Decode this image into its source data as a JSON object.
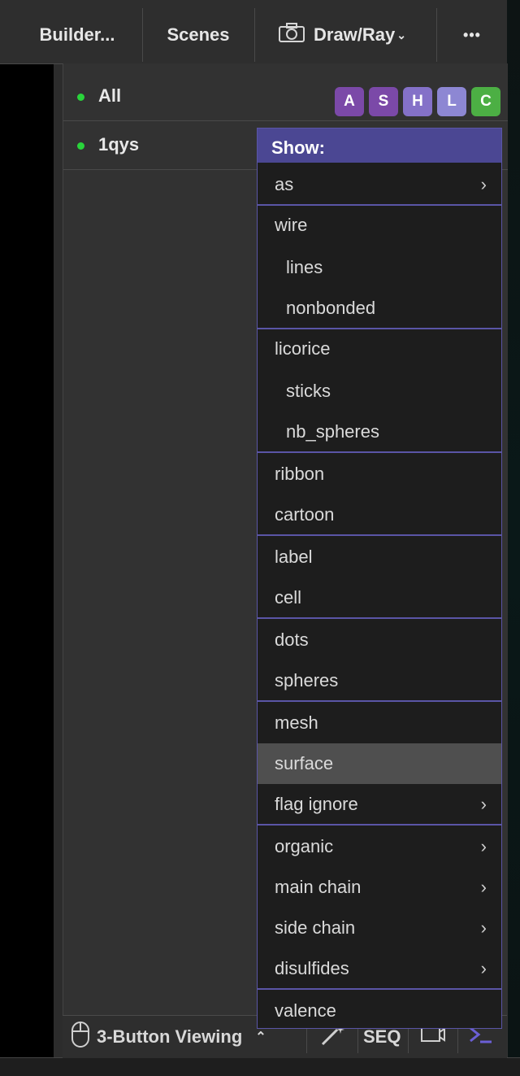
{
  "toolbar": {
    "builder_label": "Builder...",
    "scenes_label": "Scenes",
    "drawray_label": "Draw/Ray",
    "more_label": "•••"
  },
  "objects": [
    {
      "name": "All",
      "enabled": true
    },
    {
      "name": "1qys",
      "enabled": true
    }
  ],
  "ashlc": {
    "a": "A",
    "s": "S",
    "h": "H",
    "l": "L",
    "c": "C",
    "colors": {
      "a": "#7b49a8",
      "s": "#7b49a8",
      "h": "#8471c8",
      "l": "#8d87d3",
      "c": "#4caf44"
    }
  },
  "menu": {
    "title": "Show:",
    "items": [
      {
        "label": "as",
        "submenu": true
      },
      {
        "label": "wire"
      },
      {
        "label": "lines"
      },
      {
        "label": "nonbonded"
      },
      {
        "label": "licorice"
      },
      {
        "label": "sticks"
      },
      {
        "label": "nb_spheres"
      },
      {
        "label": "ribbon"
      },
      {
        "label": "cartoon"
      },
      {
        "label": "label"
      },
      {
        "label": "cell"
      },
      {
        "label": "dots"
      },
      {
        "label": "spheres"
      },
      {
        "label": "mesh"
      },
      {
        "label": "surface",
        "highlighted": true
      },
      {
        "label": "flag ignore",
        "submenu": true
      },
      {
        "label": "organic",
        "submenu": true
      },
      {
        "label": "main chain",
        "submenu": true
      },
      {
        "label": "side chain",
        "submenu": true
      },
      {
        "label": "disulfides",
        "submenu": true
      },
      {
        "label": "valence"
      }
    ]
  },
  "viewbar": {
    "mode_label": "3-Button Viewing",
    "seq_label": "SEQ"
  },
  "colors": {
    "menu_accent": "#4b4793",
    "dot_green": "#29d43b",
    "highlight": "#4f4f4f"
  }
}
